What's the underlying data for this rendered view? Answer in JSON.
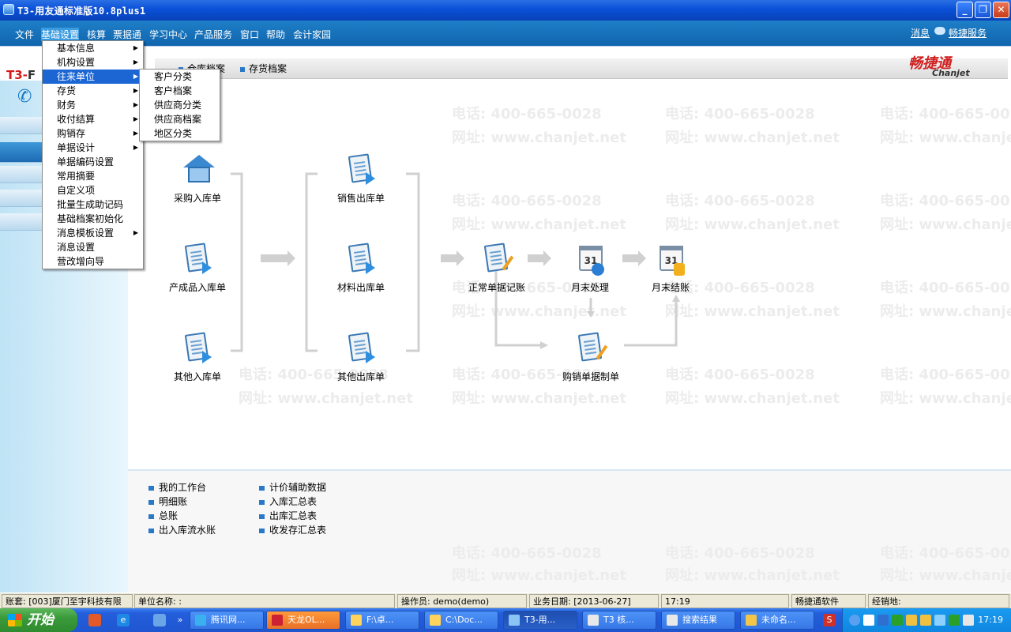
{
  "window": {
    "title": "T3-用友通标准版10.8plus1",
    "min_label": "_",
    "max_label": "❐",
    "close_label": "✕"
  },
  "menubar": {
    "items": [
      "文件",
      "基础设置",
      "核算",
      "票据通",
      "学习中心",
      "产品服务",
      "窗口",
      "帮助",
      "会计家园"
    ],
    "active_index": 1,
    "right_links": [
      "消息",
      "畅捷服务"
    ]
  },
  "header": {
    "logo_prefix": "T3-",
    "logo_rest": "F",
    "tabs": [
      "仓库档案",
      "存货档案"
    ],
    "brand_zh": "畅捷通",
    "brand_en": "Chanjet"
  },
  "dropdown_main": {
    "items": [
      {
        "label": "基本信息",
        "has_sub": true
      },
      {
        "label": "机构设置",
        "has_sub": true
      },
      {
        "label": "往来单位",
        "has_sub": true
      },
      {
        "label": "存货",
        "has_sub": true
      },
      {
        "label": "财务",
        "has_sub": true
      },
      {
        "label": "收付结算",
        "has_sub": true
      },
      {
        "label": "购销存",
        "has_sub": true
      },
      {
        "label": "单据设计",
        "has_sub": true
      },
      {
        "label": "单据编码设置",
        "has_sub": false
      },
      {
        "label": "常用摘要",
        "has_sub": false
      },
      {
        "label": "自定义项",
        "has_sub": false
      },
      {
        "label": "批量生成助记码",
        "has_sub": false
      },
      {
        "label": "基础档案初始化",
        "has_sub": false
      },
      {
        "label": "消息模板设置",
        "has_sub": true
      },
      {
        "label": "消息设置",
        "has_sub": false
      },
      {
        "label": "营改增向导",
        "has_sub": false
      }
    ],
    "highlight_index": 2
  },
  "dropdown_sub": {
    "items": [
      "客户分类",
      "客户档案",
      "供应商分类",
      "供应商档案",
      "地区分类"
    ]
  },
  "flow": {
    "nodes": {
      "purchase_in": "采购入库单",
      "product_in": "产成品入库单",
      "other_in": "其他入库单",
      "sales_out": "销售出库单",
      "material_out": "材料出库单",
      "other_out": "其他出库单",
      "normal_post": "正常单据记账",
      "month_process": "月末处理",
      "month_close": "月末结账",
      "purchase_sales_voucher": "购销单据制单"
    },
    "month_process_day": "31",
    "month_close_day": "31"
  },
  "watermark": {
    "phone": "电话: 400-665-0028",
    "site": "网址: www.chanjet.net"
  },
  "links": {
    "col1": [
      "我的工作台",
      "明细账",
      "总账",
      "出入库流水账"
    ],
    "col2": [
      "计价辅助数据",
      "入库汇总表",
      "出库汇总表",
      "收发存汇总表"
    ]
  },
  "statusbar": {
    "account": "账套: [003]厦门至宇科技有限",
    "unit": "单位名称: :",
    "operator": "操作员: demo(demo)",
    "business_date": "业务日期: [2013-06-27]",
    "time": "17:19",
    "software": "畅捷通软件",
    "dealer": "经销地:"
  },
  "taskbar": {
    "start": "开始",
    "tasks": [
      "腾讯网...",
      "天龙OL...",
      "F:\\卓...",
      "C:\\Doc...",
      "T3-用...",
      "T3 核...",
      "搜索结果",
      "未命名..."
    ],
    "active_index": 4,
    "clock": "17:19"
  },
  "colors": {
    "titlebar": "#0a50d8",
    "menubar": "#1e7fc8",
    "highlight": "#1c66d4",
    "brand_red": "#d11f1f"
  }
}
